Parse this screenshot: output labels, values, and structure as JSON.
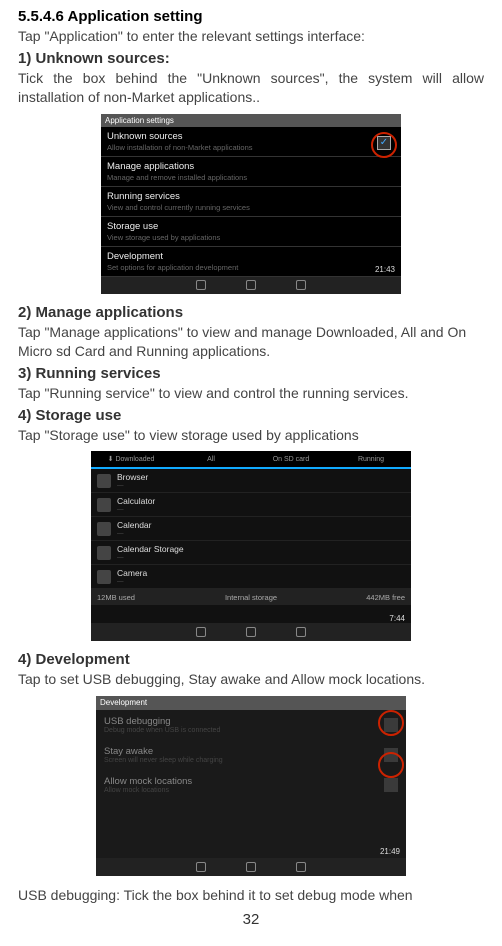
{
  "section_number": "5.5.4.6 Application setting",
  "intro": "Tap \"Application\" to enter the relevant settings interface:",
  "h1": "1) Unknown sources:",
  "p1": "Tick the box behind the \"Unknown sources\", the system will allow installation of non-Market applications..",
  "shot1": {
    "title": "Application settings",
    "items": [
      {
        "main": "Unknown sources",
        "sub": "Allow installation of non-Market applications"
      },
      {
        "main": "Manage applications",
        "sub": "Manage and remove installed applications"
      },
      {
        "main": "Running services",
        "sub": "View and control currently running services"
      },
      {
        "main": "Storage use",
        "sub": "View storage used by applications"
      },
      {
        "main": "Development",
        "sub": "Set options for application development"
      }
    ],
    "time": "21:43"
  },
  "h2": "2) Manage applications",
  "p2": "Tap \"Manage applications\" to view and manage Downloaded, All and On Micro sd Card and Running applications.",
  "h3": "3) Running services",
  "p3": "Tap \"Running service\" to view and control the running services.",
  "h4": "4) Storage use",
  "p4": "Tap \"Storage use\" to view storage used by applications",
  "shot2": {
    "tabs": [
      "Downloaded",
      "All",
      "On SD card",
      "Running"
    ],
    "apps": [
      {
        "name": "Browser",
        "sub": "—"
      },
      {
        "name": "Calculator",
        "sub": "—"
      },
      {
        "name": "Calendar",
        "sub": "—"
      },
      {
        "name": "Calendar Storage",
        "sub": "—"
      },
      {
        "name": "Camera",
        "sub": "—"
      }
    ],
    "left": "12MB used",
    "center": "Internal storage",
    "right": "442MB free",
    "time": "7:44"
  },
  "h5": "4) Development",
  "p5": "Tap to set USB debugging, Stay awake and Allow mock locations.",
  "shot3": {
    "title": "Development",
    "items": [
      {
        "main": "USB debugging",
        "sub": "Debug mode when USB is connected"
      },
      {
        "main": "Stay awake",
        "sub": "Screen will never sleep while charging"
      },
      {
        "main": "Allow mock locations",
        "sub": "Allow mock locations"
      }
    ],
    "time": "21:49"
  },
  "p6": "USB debugging: Tick the box behind it to set debug mode when",
  "page": "32"
}
